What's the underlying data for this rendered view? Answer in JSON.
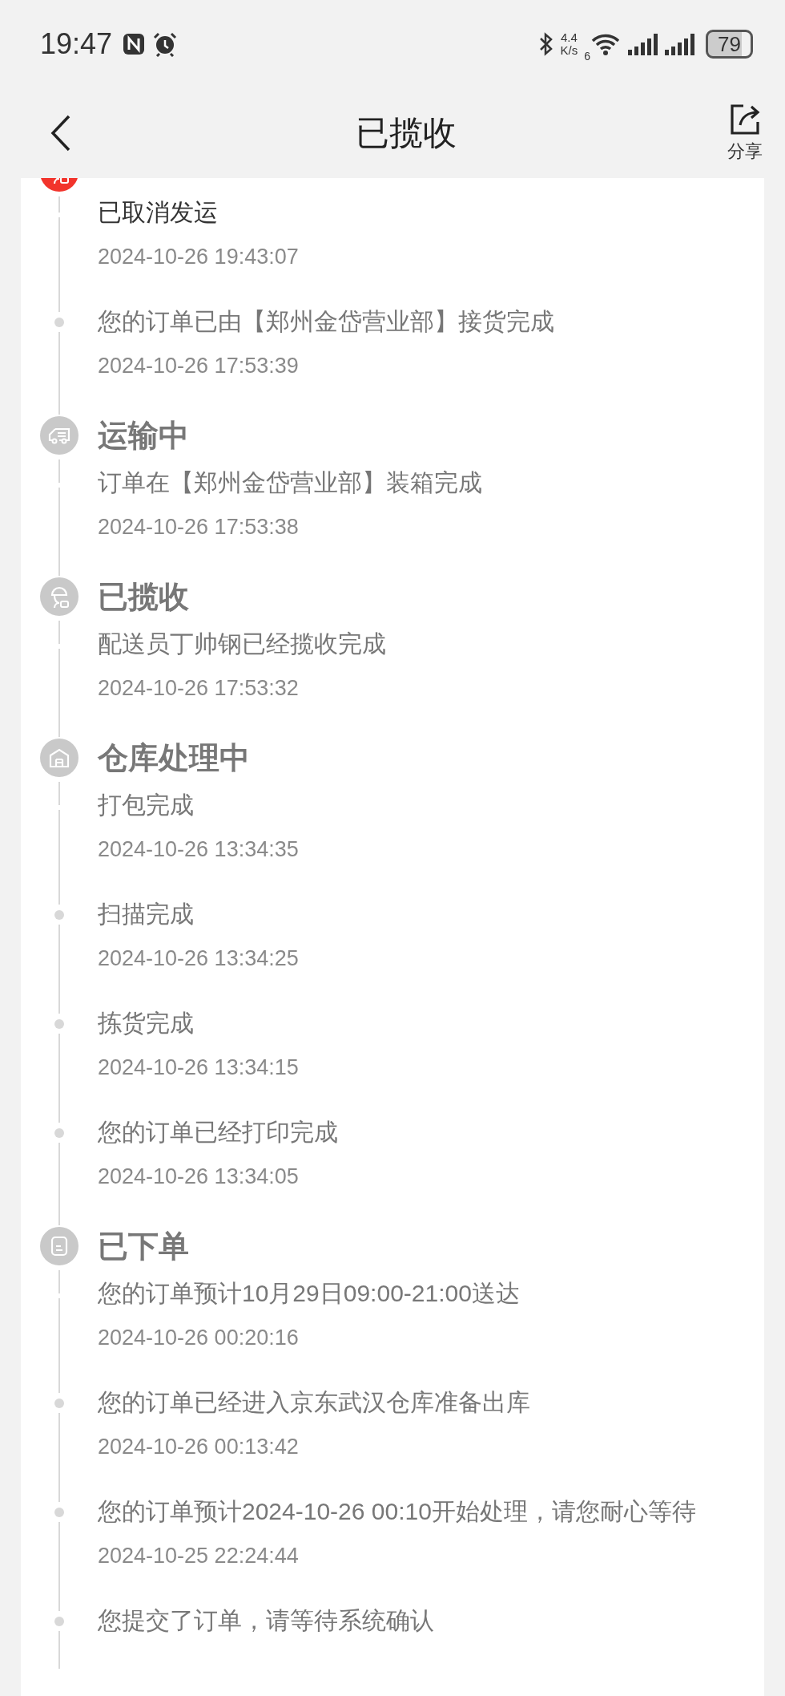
{
  "status_bar": {
    "time": "19:47",
    "net_speed_value": "4.4",
    "net_speed_unit": "K/s",
    "wifi_badge": "6",
    "battery": "79"
  },
  "header": {
    "title": "已揽收",
    "share_label": "分享"
  },
  "timeline": [
    {
      "kind": "courier",
      "active": true,
      "events": [
        {
          "text": "已取消发运",
          "time": "2024-10-26 19:43:07",
          "current": true
        },
        {
          "text": "您的订单已由【郑州金岱营业部】接货完成",
          "time": "2024-10-26 17:53:39",
          "current": false
        }
      ]
    },
    {
      "kind": "truck",
      "active": false,
      "title": "运输中",
      "events": [
        {
          "text": "订单在【郑州金岱营业部】装箱完成",
          "time": "2024-10-26 17:53:38",
          "current": false
        }
      ]
    },
    {
      "kind": "courier",
      "active": false,
      "title": "已揽收",
      "events": [
        {
          "text": "配送员丁帅钢已经揽收完成",
          "time": "2024-10-26 17:53:32",
          "current": false
        }
      ]
    },
    {
      "kind": "warehouse",
      "active": false,
      "title": "仓库处理中",
      "events": [
        {
          "text": "打包完成",
          "time": "2024-10-26 13:34:35",
          "current": false
        },
        {
          "text": "扫描完成",
          "time": "2024-10-26 13:34:25",
          "current": false
        },
        {
          "text": "拣货完成",
          "time": "2024-10-26 13:34:15",
          "current": false
        },
        {
          "text": "您的订单已经打印完成",
          "time": "2024-10-26 13:34:05",
          "current": false
        }
      ]
    },
    {
      "kind": "order",
      "active": false,
      "title": "已下单",
      "events": [
        {
          "text": "您的订单预计10月29日09:00-21:00送达",
          "time": "2024-10-26 00:20:16",
          "current": false
        },
        {
          "text": "您的订单已经进入京东武汉仓库准备出库",
          "time": "2024-10-26 00:13:42",
          "current": false
        },
        {
          "text": "您的订单预计2024-10-26 00:10开始处理，请您耐心等待",
          "time": "2024-10-25 22:24:44",
          "current": false
        },
        {
          "text": "您提交了订单，请等待系统确认",
          "current": false
        }
      ]
    }
  ]
}
